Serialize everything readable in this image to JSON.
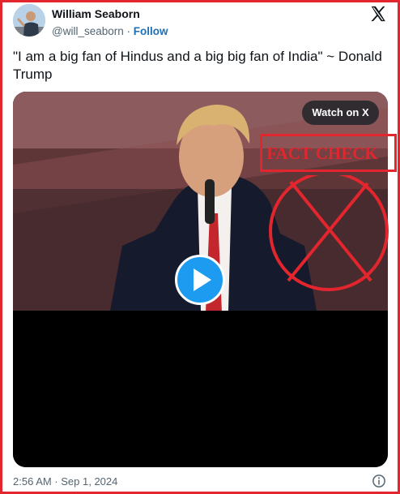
{
  "author": {
    "name": "William Seaborn",
    "handle": "@will_seaborn",
    "separator": "·",
    "follow_label": "Follow"
  },
  "tweet": {
    "text": "\"I am a big fan of Hindus and a big big fan of India\" ~ Donald Trump",
    "timestamp": "2:56 AM · Sep 1, 2024"
  },
  "media": {
    "watch_label": "Watch on X",
    "play_icon": "play-icon"
  },
  "overlay": {
    "fact_check_label": "FACT CHECK",
    "stamp_icon": "crossed-circle-icon"
  },
  "icons": {
    "brand": "x-logo-icon",
    "info": "info-icon"
  },
  "colors": {
    "overlay_red": "#e3262e",
    "follow_blue": "#1d6fb8",
    "play_blue": "#1d9bf0",
    "muted_text": "#536471"
  }
}
